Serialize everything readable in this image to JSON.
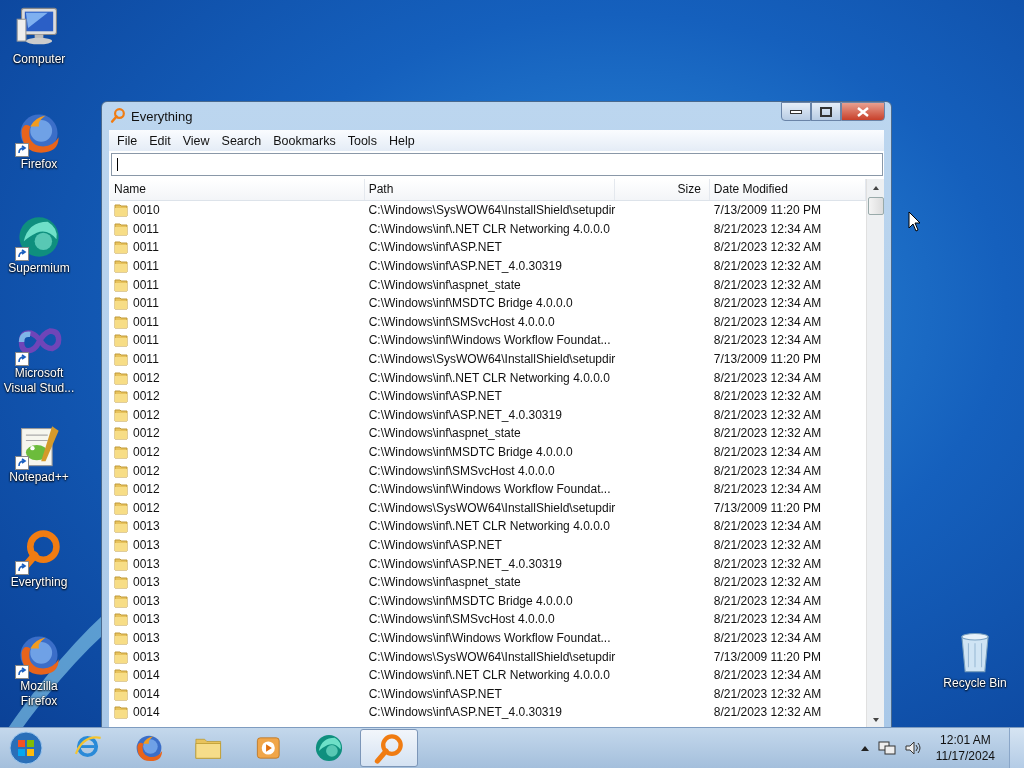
{
  "desktop_icons": [
    {
      "label": "Computer",
      "kind": "computer",
      "shortcut": false
    },
    {
      "label": "Firefox",
      "kind": "firefox",
      "shortcut": true
    },
    {
      "label": "Supermium",
      "kind": "supermium",
      "shortcut": true
    },
    {
      "label": "Microsoft Visual Stud...",
      "kind": "infinity",
      "shortcut": true
    },
    {
      "label": "Notepad++",
      "kind": "notepad",
      "shortcut": true
    },
    {
      "label": "Everything",
      "kind": "everything",
      "shortcut": true
    },
    {
      "label": "Mozilla Firefox",
      "kind": "firefox",
      "shortcut": true
    }
  ],
  "recycle_bin": {
    "label": "Recycle Bin",
    "kind": "recycle",
    "shortcut": false
  },
  "window": {
    "title": "Everything",
    "menu": [
      "File",
      "Edit",
      "View",
      "Search",
      "Bookmarks",
      "Tools",
      "Help"
    ],
    "columns": [
      "Name",
      "Path",
      "Size",
      "Date Modified"
    ],
    "rows": [
      {
        "name": "0010",
        "path": "C:\\Windows\\SysWOW64\\InstallShield\\setupdir",
        "date": "7/13/2009 11:20 PM"
      },
      {
        "name": "0011",
        "path": "C:\\Windows\\inf\\.NET CLR Networking 4.0.0.0",
        "date": "8/21/2023 12:34 AM"
      },
      {
        "name": "0011",
        "path": "C:\\Windows\\inf\\ASP.NET",
        "date": "8/21/2023 12:32 AM"
      },
      {
        "name": "0011",
        "path": "C:\\Windows\\inf\\ASP.NET_4.0.30319",
        "date": "8/21/2023 12:32 AM"
      },
      {
        "name": "0011",
        "path": "C:\\Windows\\inf\\aspnet_state",
        "date": "8/21/2023 12:32 AM"
      },
      {
        "name": "0011",
        "path": "C:\\Windows\\inf\\MSDTC Bridge 4.0.0.0",
        "date": "8/21/2023 12:34 AM"
      },
      {
        "name": "0011",
        "path": "C:\\Windows\\inf\\SMSvcHost 4.0.0.0",
        "date": "8/21/2023 12:34 AM"
      },
      {
        "name": "0011",
        "path": "C:\\Windows\\inf\\Windows Workflow Foundat...",
        "date": "8/21/2023 12:34 AM"
      },
      {
        "name": "0011",
        "path": "C:\\Windows\\SysWOW64\\InstallShield\\setupdir",
        "date": "7/13/2009 11:20 PM"
      },
      {
        "name": "0012",
        "path": "C:\\Windows\\inf\\.NET CLR Networking 4.0.0.0",
        "date": "8/21/2023 12:34 AM"
      },
      {
        "name": "0012",
        "path": "C:\\Windows\\inf\\ASP.NET",
        "date": "8/21/2023 12:32 AM"
      },
      {
        "name": "0012",
        "path": "C:\\Windows\\inf\\ASP.NET_4.0.30319",
        "date": "8/21/2023 12:32 AM"
      },
      {
        "name": "0012",
        "path": "C:\\Windows\\inf\\aspnet_state",
        "date": "8/21/2023 12:32 AM"
      },
      {
        "name": "0012",
        "path": "C:\\Windows\\inf\\MSDTC Bridge 4.0.0.0",
        "date": "8/21/2023 12:34 AM"
      },
      {
        "name": "0012",
        "path": "C:\\Windows\\inf\\SMSvcHost 4.0.0.0",
        "date": "8/21/2023 12:34 AM"
      },
      {
        "name": "0012",
        "path": "C:\\Windows\\inf\\Windows Workflow Foundat...",
        "date": "8/21/2023 12:34 AM"
      },
      {
        "name": "0012",
        "path": "C:\\Windows\\SysWOW64\\InstallShield\\setupdir",
        "date": "7/13/2009 11:20 PM"
      },
      {
        "name": "0013",
        "path": "C:\\Windows\\inf\\.NET CLR Networking 4.0.0.0",
        "date": "8/21/2023 12:34 AM"
      },
      {
        "name": "0013",
        "path": "C:\\Windows\\inf\\ASP.NET",
        "date": "8/21/2023 12:32 AM"
      },
      {
        "name": "0013",
        "path": "C:\\Windows\\inf\\ASP.NET_4.0.30319",
        "date": "8/21/2023 12:32 AM"
      },
      {
        "name": "0013",
        "path": "C:\\Windows\\inf\\aspnet_state",
        "date": "8/21/2023 12:32 AM"
      },
      {
        "name": "0013",
        "path": "C:\\Windows\\inf\\MSDTC Bridge 4.0.0.0",
        "date": "8/21/2023 12:34 AM"
      },
      {
        "name": "0013",
        "path": "C:\\Windows\\inf\\SMSvcHost 4.0.0.0",
        "date": "8/21/2023 12:34 AM"
      },
      {
        "name": "0013",
        "path": "C:\\Windows\\inf\\Windows Workflow Foundat...",
        "date": "8/21/2023 12:34 AM"
      },
      {
        "name": "0013",
        "path": "C:\\Windows\\SysWOW64\\InstallShield\\setupdir",
        "date": "7/13/2009 11:20 PM"
      },
      {
        "name": "0014",
        "path": "C:\\Windows\\inf\\.NET CLR Networking 4.0.0.0",
        "date": "8/21/2023 12:34 AM"
      },
      {
        "name": "0014",
        "path": "C:\\Windows\\inf\\ASP.NET",
        "date": "8/21/2023 12:32 AM"
      },
      {
        "name": "0014",
        "path": "C:\\Windows\\inf\\ASP.NET_4.0.30319",
        "date": "8/21/2023 12:32 AM"
      }
    ]
  },
  "taskbar": {
    "items": [
      {
        "kind": "ie",
        "selected": false
      },
      {
        "kind": "firefox",
        "selected": false
      },
      {
        "kind": "folder",
        "selected": false
      },
      {
        "kind": "media",
        "selected": false
      },
      {
        "kind": "supermium",
        "selected": false
      },
      {
        "kind": "everything",
        "selected": true
      }
    ],
    "time": "12:01 AM",
    "date": "11/17/2024"
  }
}
